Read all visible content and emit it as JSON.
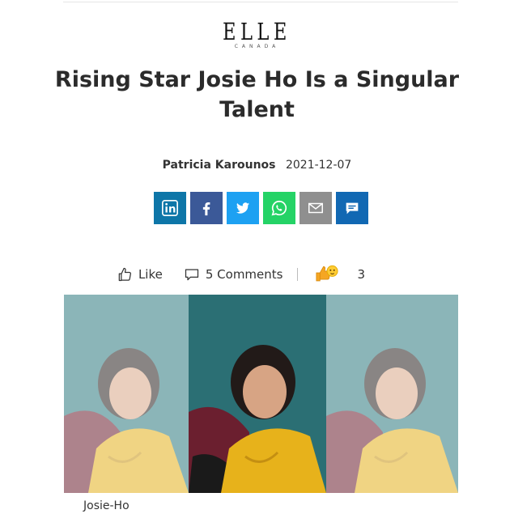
{
  "brand": {
    "logo_main": "ELLE",
    "logo_sub": "CANADA"
  },
  "article": {
    "title": "Rising Star Josie Ho Is a Singular Talent",
    "author": "Patricia Karounos",
    "date": "2021-12-07"
  },
  "share": {
    "buttons": [
      {
        "name": "linkedin",
        "color": "#0e76a8",
        "icon": "linkedin-icon"
      },
      {
        "name": "facebook",
        "color": "#3b5998",
        "icon": "facebook-icon"
      },
      {
        "name": "twitter",
        "color": "#1da1f2",
        "icon": "twitter-icon"
      },
      {
        "name": "whatsapp",
        "color": "#25d366",
        "icon": "whatsapp-icon"
      },
      {
        "name": "email",
        "color": "#8f8f8f",
        "icon": "mail-icon"
      },
      {
        "name": "message",
        "color": "#1168b3",
        "icon": "message-icon"
      }
    ]
  },
  "actions": {
    "like_label": "Like",
    "comments_label": "5 Comments",
    "reaction_count": "3"
  },
  "gallery": {
    "caption": "Josie-Ho"
  }
}
